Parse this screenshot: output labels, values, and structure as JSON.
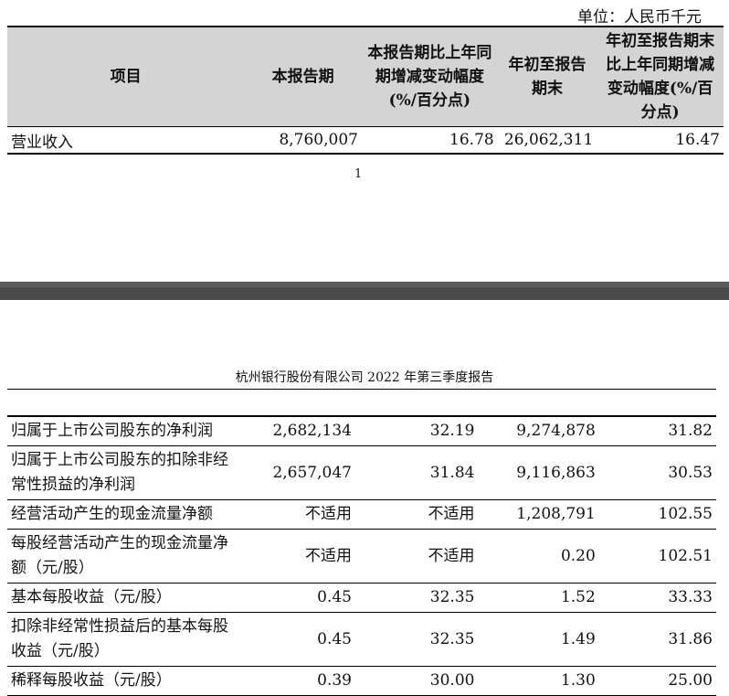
{
  "unit_label": "单位：人民币千元",
  "table1": {
    "headers": [
      "项目",
      "本报告期",
      "本报告期比上年同期增减变动幅度(%/百分点)",
      "年初至报告期末",
      "年初至报告期末比上年同期增减变动幅度(%/百分点)"
    ],
    "row": {
      "item": "营业收入",
      "current": "8,760,007",
      "change": "16.78",
      "ytd": "26,062,311",
      "ytd_change": "16.47"
    }
  },
  "page_number": "1",
  "report_header": "杭州银行股份有限公司 2022 年第三季度报告",
  "table2": {
    "rows": [
      {
        "item": "归属于上市公司股东的净利润",
        "current": "2,682,134",
        "change": "32.19",
        "ytd": "9,274,878",
        "ytd_change": "31.82"
      },
      {
        "item": "归属于上市公司股东的扣除非经常性损益的净利润",
        "current": "2,657,047",
        "change": "31.84",
        "ytd": "9,116,863",
        "ytd_change": "30.53"
      },
      {
        "item": "经营活动产生的现金流量净额",
        "current": "不适用",
        "change": "不适用",
        "ytd": "1,208,791",
        "ytd_change": "102.55"
      },
      {
        "item": "每股经营活动产生的现金流量净额（元/股）",
        "current": "不适用",
        "change": "不适用",
        "ytd": "0.20",
        "ytd_change": "102.51"
      },
      {
        "item": "基本每股收益（元/股）",
        "current": "0.45",
        "change": "32.35",
        "ytd": "1.52",
        "ytd_change": "33.33"
      },
      {
        "item": "扣除非经常性损益后的基本每股收益（元/股）",
        "current": "0.45",
        "change": "32.35",
        "ytd": "1.49",
        "ytd_change": "31.86"
      },
      {
        "item": "稀释每股收益（元/股）",
        "current": "0.39",
        "change": "30.00",
        "ytd": "1.30",
        "ytd_change": "25.00"
      }
    ]
  }
}
